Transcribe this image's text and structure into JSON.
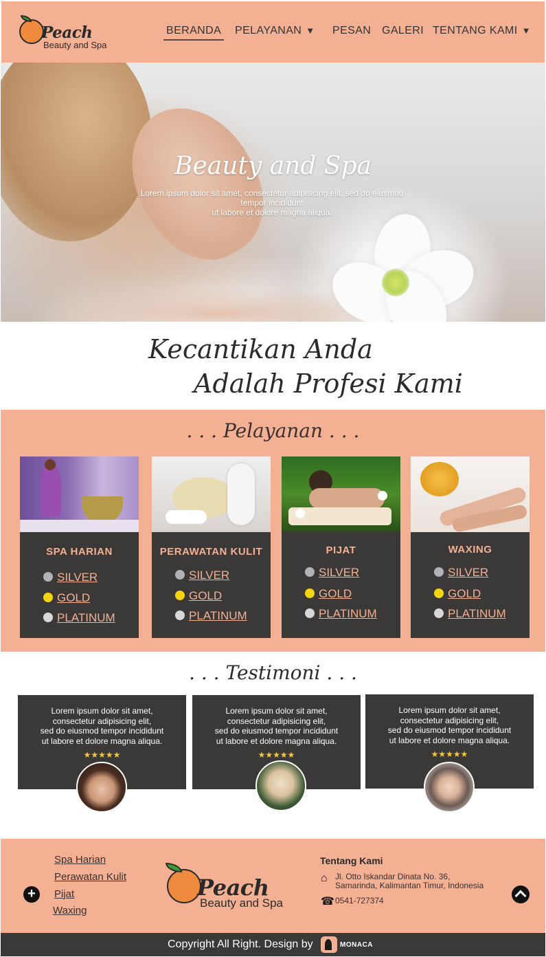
{
  "brand": {
    "name": "Peach",
    "tagline": "Beauty and Spa"
  },
  "nav": [
    {
      "label": "BERANDA",
      "dropdown": false,
      "active": true
    },
    {
      "label": "PELAYANAN",
      "dropdown": true
    },
    {
      "label": "PESAN",
      "dropdown": false
    },
    {
      "label": "GALERI",
      "dropdown": false
    },
    {
      "label": "TENTANG KAMI",
      "dropdown": true
    }
  ],
  "hero": {
    "title": "Beauty and Spa",
    "text_lines": [
      "Lorem ipsum dolor sit amet, consectetur adipisicing elit, sed do eiusmod",
      "tempor incididunt",
      "ut labore et dolore magna aliqua."
    ]
  },
  "tagline": {
    "line1": "Kecantikan Anda",
    "line2": "Adalah Profesi Kami"
  },
  "services": {
    "title": ". . . Pelayanan . . .",
    "tiers": [
      "SILVER",
      "GOLD",
      "PLATINUM"
    ],
    "tier_colors": [
      "#b3b0b8",
      "#f5d410",
      "#d8d8d8"
    ],
    "items": [
      {
        "name": "SPA HARIAN"
      },
      {
        "name": "PERAWATAN KULIT"
      },
      {
        "name": "PIJAT"
      },
      {
        "name": "WAXING"
      }
    ]
  },
  "testimoni": {
    "title": ". . . Testimoni . . .",
    "items": [
      {
        "lines": [
          "Lorem ipsum dolor sit amet,",
          "consectetur adipisicing elit,",
          "sed do eiusmod tempor incididunt",
          "ut labore et dolore magna aliqua."
        ],
        "rating": 5
      },
      {
        "lines": [
          "Lorem ipsum dolor sit amet,",
          "consectetur adipisicing elit,",
          "sed do eiusmod tempor incididunt",
          "ut labore et dolore magna aliqua."
        ],
        "rating": 5
      },
      {
        "lines": [
          "Lorem ipsum dolor sit amet,",
          "consectetur adipisicing elit,",
          "sed do eiusmod tempor incididunt",
          "ut labore et dolore magna aliqua."
        ],
        "rating": 5
      }
    ],
    "stars": "★★★★★"
  },
  "footer": {
    "links": [
      "Spa Harian",
      "Perawatan Kulit",
      "Pijat",
      "Waxing"
    ],
    "about_title": "Tentang Kami",
    "address_lines": [
      "Jl. Otto Iskandar Dinata No. 36,",
      "Samarinda, Kalimantan Timur, Indonesia"
    ],
    "phone": "0541-727374",
    "plus_icon": "+",
    "home_icon": "⌂",
    "phone_icon": "☎"
  },
  "copyright": {
    "text": "Copyright All Right. Design by",
    "brand": "MONACA"
  },
  "colors": {
    "accent": "#f3b093",
    "dark": "#3b3838"
  }
}
